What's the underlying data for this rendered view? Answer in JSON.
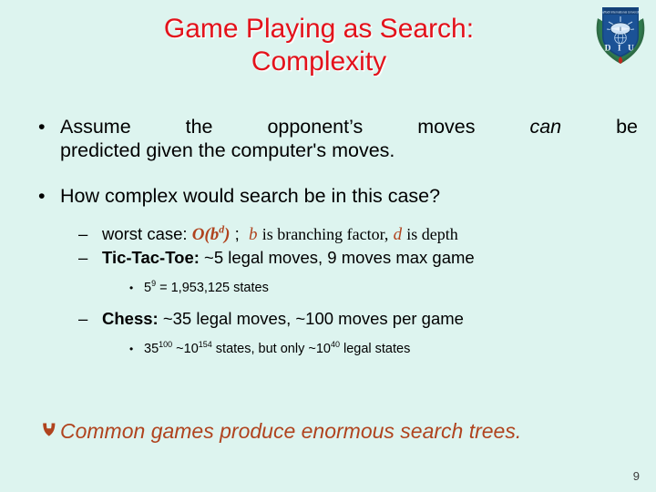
{
  "slide": {
    "background_color": "#ddf4ef",
    "title_color": "#e3121b",
    "accent_color": "#b0431e",
    "page_number": "9"
  },
  "logo": {
    "name": "Daffodil International University",
    "motto": "Daffodil International University",
    "letters": "D I U"
  },
  "title": {
    "line1": "Game Playing as Search:",
    "line2": "Complexity"
  },
  "content": {
    "bullet1": {
      "marker": "•",
      "line1_part1": "Assume",
      "line1_part2": "the",
      "line1_part3": "opponent’s",
      "line1_part4": "moves",
      "line1_italic": "can",
      "line1_part5": "be",
      "line2": "predicted given the computer's moves."
    },
    "bullet2": {
      "marker": "•",
      "text": "How complex would search be in this case?"
    },
    "sub1": {
      "marker": "–",
      "label": "worst case:",
      "formula_base": "O(b",
      "formula_sup": "d",
      "formula_close": ")",
      "separator": ";",
      "var_b": "b",
      "text_b": "is branching factor,",
      "var_d": "d",
      "text_d": "is depth"
    },
    "sub2": {
      "marker": "–",
      "label": "Tic-Tac-Toe:",
      "text": "~5 legal moves, 9 moves max game"
    },
    "sub2_detail": {
      "marker": "•",
      "base": "5",
      "sup": "9",
      "rest": " = 1,953,125 states"
    },
    "sub3": {
      "marker": "–",
      "label": "Chess:",
      "text": "~35 legal moves, ~100 moves per game"
    },
    "sub3_detail": {
      "marker": "•",
      "base1": "35",
      "sup1": "100",
      "mid1": " ~10",
      "sup2": "154",
      "mid2": " states, but only ~10",
      "sup3": "40",
      "tail": " legal states"
    },
    "closing": {
      "marker": "↱",
      "text": "Common games produce enormous search trees."
    }
  }
}
